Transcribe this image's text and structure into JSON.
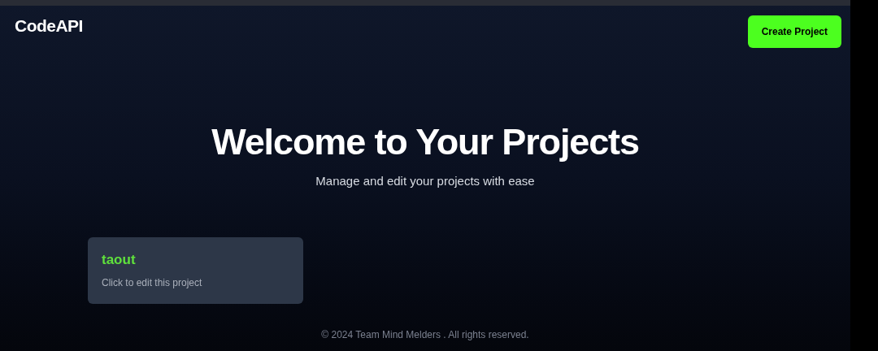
{
  "brand": "CodeAPI",
  "header_button": "Create Project",
  "hero": {
    "title": "Welcome to Your Projects",
    "subtitle": "Manage and edit your projects with ease"
  },
  "projects": [
    {
      "name": "taout",
      "hint": "Click to edit this project"
    }
  ],
  "footer": "© 2024 Team Mind Melders . All rights reserved."
}
